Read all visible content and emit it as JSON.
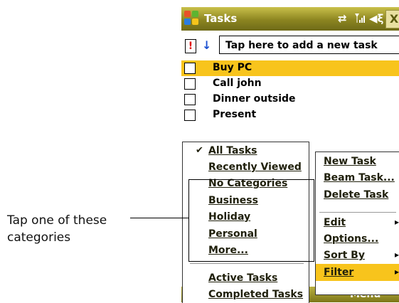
{
  "titlebar": {
    "app_title": "Tasks",
    "icons": [
      "windows-logo",
      "sync-arrows-icon",
      "signal-icon",
      "speaker-icon",
      "close-icon"
    ],
    "close_label": "X"
  },
  "new_task": {
    "high_priority_label": "!",
    "low_priority_label": "↓",
    "placeholder": "Tap here to add a new task"
  },
  "tasks": [
    {
      "label": "Buy PC",
      "selected": true
    },
    {
      "label": "Call john",
      "selected": false
    },
    {
      "label": "Dinner outside",
      "selected": false
    },
    {
      "label": "Present",
      "selected": false
    }
  ],
  "filter_menu": {
    "items": [
      {
        "label": "All Tasks",
        "checked": true
      },
      {
        "label": "Recently Viewed"
      },
      {
        "label": "No Categories"
      },
      {
        "label": "Business"
      },
      {
        "label": "Holiday"
      },
      {
        "label": "Personal"
      },
      {
        "label": "More..."
      },
      {
        "label": "Active Tasks"
      },
      {
        "label": "Completed Tasks"
      }
    ],
    "check_glyph": "✔"
  },
  "main_menu": {
    "items": [
      {
        "label": "New Task"
      },
      {
        "label": "Beam Task..."
      },
      {
        "label": "Delete Task"
      },
      {
        "label": "Edit",
        "submenu": true
      },
      {
        "label": "Options..."
      },
      {
        "label": "Sort By",
        "submenu": true
      },
      {
        "label": "Filter",
        "submenu": true,
        "selected": true
      }
    ],
    "arrow_glyph": "▸"
  },
  "softkeys": {
    "right": "Menu"
  },
  "callout": {
    "text": "Tap one of these categories"
  },
  "colors": {
    "titlebar": "#8c8520",
    "selection": "#f8c41c",
    "text": "#20200c"
  }
}
